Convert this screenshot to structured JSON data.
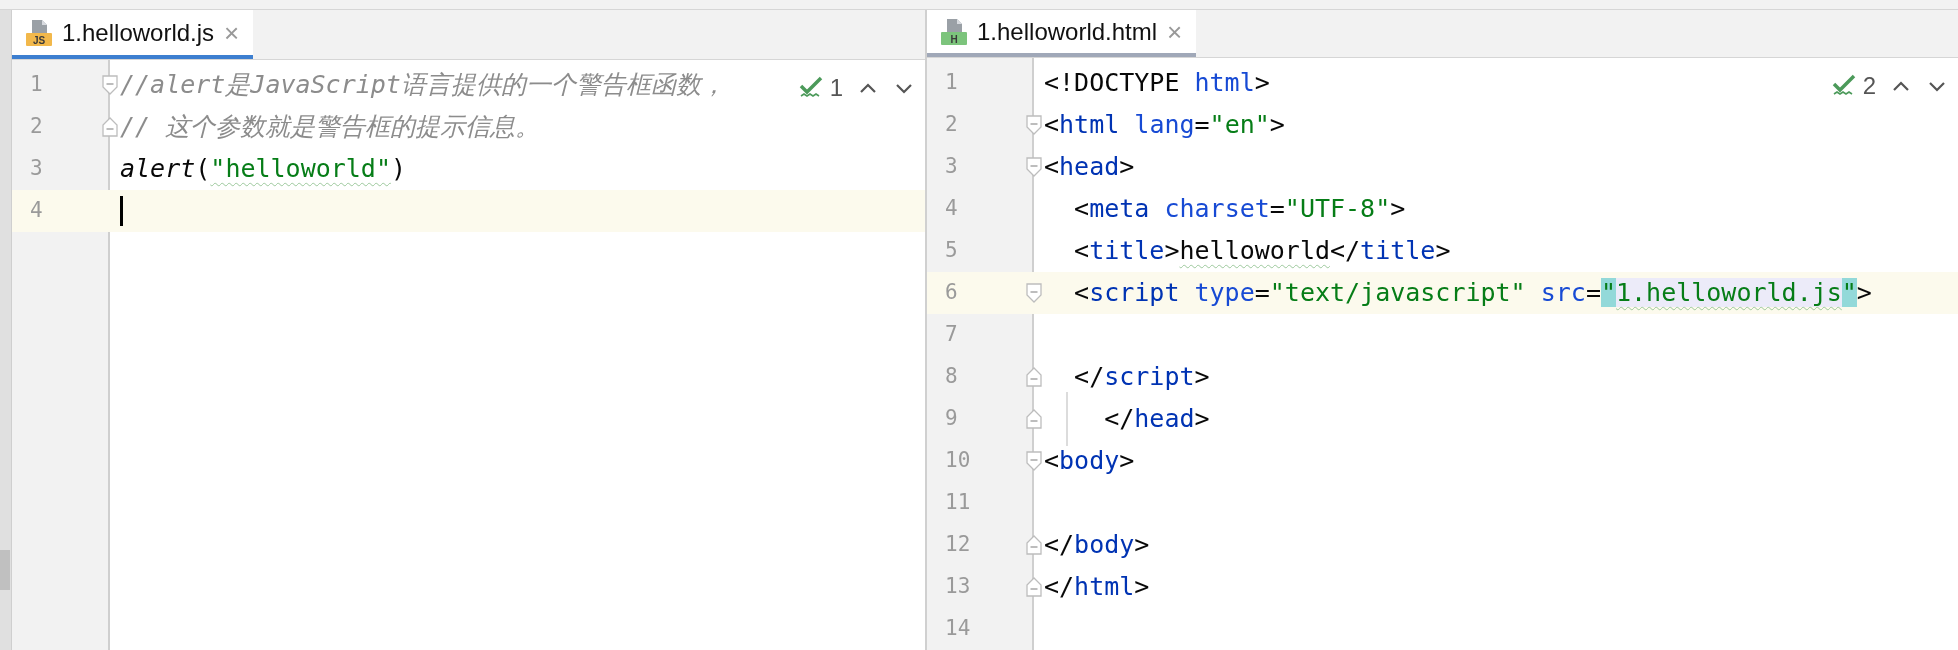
{
  "panes": [
    {
      "active": true,
      "tabs": [
        {
          "label": "1.helloworld.js",
          "icon_label": "JS",
          "kind": "js",
          "selected": true,
          "close": "×"
        }
      ],
      "inspection": {
        "count": "1"
      },
      "lines": [
        {
          "number": "1",
          "fold_marker": {
            "kind": "start"
          },
          "tokens": [
            {
              "t": "//alert是JavaScript语言提供的一个警告框函数，",
              "kind": "comment"
            }
          ]
        },
        {
          "number": "2",
          "fold_marker": {
            "kind": "end"
          },
          "tokens": [
            {
              "t": "// 这个参数就是警告框的提示信息。",
              "kind": "comment"
            }
          ]
        },
        {
          "number": "3",
          "tokens": [
            {
              "t": "alert",
              "kind": "func"
            },
            {
              "t": "(",
              "kind": "plain"
            },
            {
              "t": "\"helloworld\"",
              "kind": "string",
              "warning": true
            },
            {
              "t": ")",
              "kind": "plain"
            }
          ]
        },
        {
          "number": "4",
          "current": true,
          "caret": true
        }
      ]
    },
    {
      "active": false,
      "tabs": [
        {
          "label": "1.helloworld.html",
          "icon_label": "H",
          "kind": "html",
          "selected": true,
          "close": "×"
        }
      ],
      "inspection": {
        "count": "2"
      },
      "lines": [
        {
          "number": "1",
          "tokens": [
            {
              "t": "<!DOCTYPE ",
              "kind": "plain"
            },
            {
              "t": "html",
              "kind": "attr"
            },
            {
              "t": ">",
              "kind": "plain"
            }
          ]
        },
        {
          "number": "2",
          "fold_marker": {
            "kind": "start"
          },
          "tokens": [
            {
              "t": "<",
              "kind": "plain"
            },
            {
              "t": "html ",
              "kind": "tag"
            },
            {
              "t": "lang",
              "kind": "attr"
            },
            {
              "t": "=",
              "kind": "plain"
            },
            {
              "t": "\"en\"",
              "kind": "string"
            },
            {
              "t": ">",
              "kind": "plain"
            }
          ]
        },
        {
          "number": "3",
          "fold_marker": {
            "kind": "start"
          },
          "tokens": [
            {
              "t": "<",
              "kind": "plain"
            },
            {
              "t": "head",
              "kind": "tag"
            },
            {
              "t": ">",
              "kind": "plain"
            }
          ]
        },
        {
          "number": "4",
          "tokens": [
            {
              "t": "  <",
              "kind": "plain"
            },
            {
              "t": "meta ",
              "kind": "tag"
            },
            {
              "t": "charset",
              "kind": "attr"
            },
            {
              "t": "=",
              "kind": "plain"
            },
            {
              "t": "\"UTF-8\"",
              "kind": "string"
            },
            {
              "t": ">",
              "kind": "plain"
            }
          ]
        },
        {
          "number": "5",
          "tokens": [
            {
              "t": "  <",
              "kind": "plain"
            },
            {
              "t": "title",
              "kind": "tag"
            },
            {
              "t": ">",
              "kind": "plain"
            },
            {
              "t": "helloworld",
              "kind": "plain",
              "warning": true
            },
            {
              "t": "</",
              "kind": "plain"
            },
            {
              "t": "title",
              "kind": "tag"
            },
            {
              "t": ">",
              "kind": "plain"
            }
          ]
        },
        {
          "number": "6",
          "fold_marker": {
            "kind": "start"
          },
          "current": true,
          "tokens": [
            {
              "t": "  <",
              "kind": "plain"
            },
            {
              "t": "script ",
              "kind": "tag"
            },
            {
              "t": "type",
              "kind": "attr"
            },
            {
              "t": "=",
              "kind": "plain"
            },
            {
              "t": "\"text/javascript\" ",
              "kind": "string"
            },
            {
              "t": "src",
              "kind": "attr"
            },
            {
              "t": "=",
              "kind": "plain"
            },
            {
              "t": "\"",
              "kind": "string",
              "paired": true
            },
            {
              "t": "1.helloworld.js",
              "kind": "string",
              "warning": true,
              "reference": true
            },
            {
              "t": "\"",
              "kind": "string",
              "paired": true
            },
            {
              "t": ">",
              "kind": "plain"
            }
          ]
        },
        {
          "number": "7"
        },
        {
          "number": "8",
          "fold_marker": {
            "kind": "end"
          },
          "tokens": [
            {
              "t": "  </",
              "kind": "plain"
            },
            {
              "t": "script",
              "kind": "tag"
            },
            {
              "t": ">",
              "kind": "plain"
            }
          ]
        },
        {
          "number": "9",
          "fold_marker": {
            "kind": "end"
          },
          "guide": true,
          "tokens": [
            {
              "t": "    </",
              "kind": "plain"
            },
            {
              "t": "head",
              "kind": "tag"
            },
            {
              "t": ">",
              "kind": "plain"
            }
          ]
        },
        {
          "number": "10",
          "fold_marker": {
            "kind": "start"
          },
          "tokens": [
            {
              "t": "<",
              "kind": "plain"
            },
            {
              "t": "body",
              "kind": "tag"
            },
            {
              "t": ">",
              "kind": "plain"
            }
          ]
        },
        {
          "number": "11"
        },
        {
          "number": "12",
          "fold_marker": {
            "kind": "end"
          },
          "tokens": [
            {
              "t": "</",
              "kind": "plain"
            },
            {
              "t": "body",
              "kind": "tag"
            },
            {
              "t": ">",
              "kind": "plain"
            }
          ]
        },
        {
          "number": "13",
          "fold_marker": {
            "kind": "end"
          },
          "tokens": [
            {
              "t": "</",
              "kind": "plain"
            },
            {
              "t": "html",
              "kind": "tag"
            },
            {
              "t": ">",
              "kind": "plain"
            }
          ]
        },
        {
          "number": "14"
        }
      ]
    }
  ]
}
